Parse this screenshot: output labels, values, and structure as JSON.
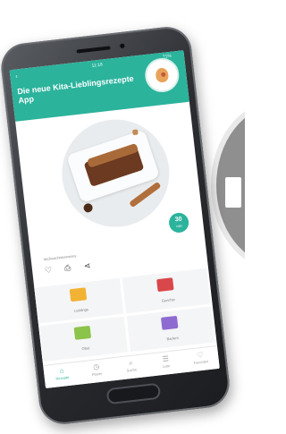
{
  "app": {
    "title": "Die neue Kita-Lieblingsrezepte App",
    "status_time": "11:18",
    "status_battery": "71%"
  },
  "header": {
    "back_glyph": "‹",
    "logo_icon": "kita-logo-icon"
  },
  "recipe": {
    "name": "Weihnachtsbrownies",
    "time_value": "30",
    "time_unit": "min"
  },
  "actions": [
    {
      "icon": "heart-icon",
      "glyph": "♡"
    },
    {
      "icon": "printer-icon",
      "glyph": "⎙"
    },
    {
      "icon": "share-icon",
      "glyph": "⋖"
    }
  ],
  "categories": [
    {
      "label": "Lieblings",
      "color": "#f2b233"
    },
    {
      "label": "Gerichte",
      "color": "#d9474a"
    },
    {
      "label": "Obst",
      "color": "#8cc34a"
    },
    {
      "label": "Backen",
      "color": "#8e6bd1"
    }
  ],
  "bottom_nav": [
    {
      "label": "Rezepte",
      "glyph": "⌂",
      "active": true
    },
    {
      "label": "Planer",
      "glyph": "◷",
      "active": false
    },
    {
      "label": "Suche",
      "glyph": "⌕",
      "active": false
    },
    {
      "label": "Liste",
      "glyph": "☰",
      "active": false
    },
    {
      "label": "Favoriten",
      "glyph": "♡",
      "active": false
    }
  ],
  "colors": {
    "accent": "#2bb39c",
    "phone_frame": "#2b2d31"
  }
}
